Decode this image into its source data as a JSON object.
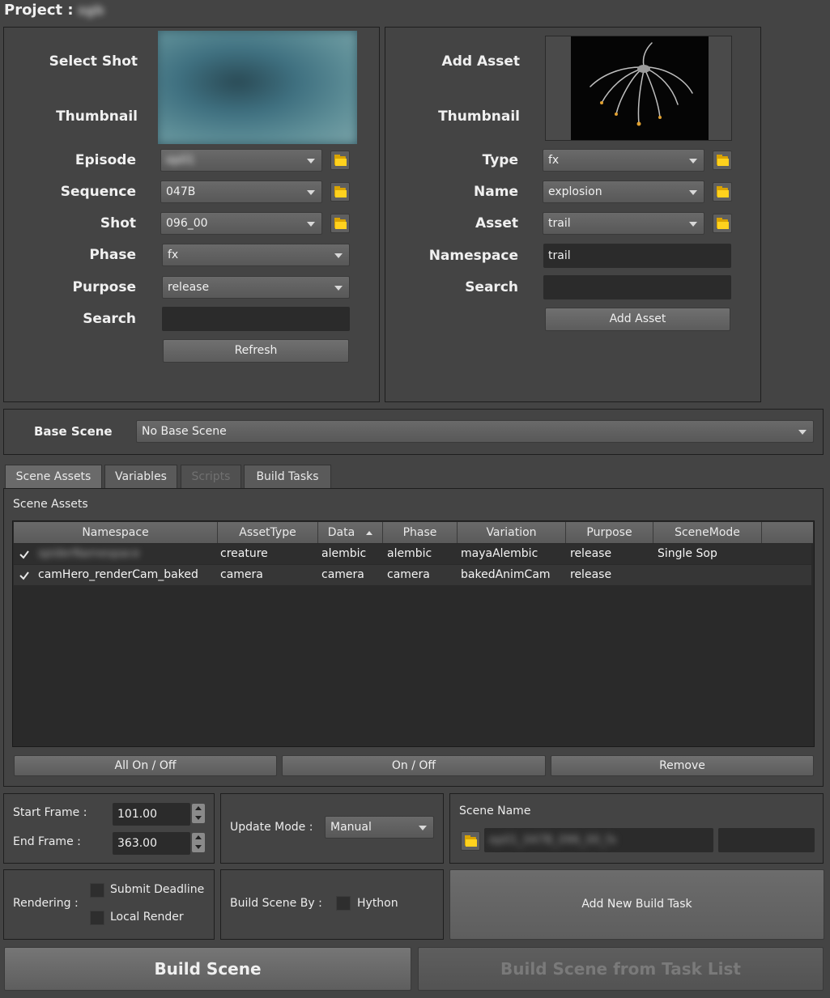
{
  "project": {
    "label": "Project :",
    "value": "sgb"
  },
  "shot_panel": {
    "select_shot": "Select Shot",
    "thumbnail": "Thumbnail",
    "episode_label": "Episode",
    "episode_value": "ep01",
    "sequence_label": "Sequence",
    "sequence_value": "047B",
    "shot_label": "Shot",
    "shot_value": "096_00",
    "phase_label": "Phase",
    "phase_value": "fx",
    "purpose_label": "Purpose",
    "purpose_value": "release",
    "search_label": "Search",
    "search_value": "",
    "refresh_button": "Refresh"
  },
  "asset_panel": {
    "add_asset": "Add Asset",
    "thumbnail": "Thumbnail",
    "type_label": "Type",
    "type_value": "fx",
    "name_label": "Name",
    "name_value": "explosion",
    "asset_label": "Asset",
    "asset_value": "trail",
    "namespace_label": "Namespace",
    "namespace_value": "trail",
    "search_label": "Search",
    "search_value": "",
    "add_asset_button": "Add Asset"
  },
  "base_scene": {
    "label": "Base Scene",
    "value": "No Base Scene"
  },
  "tabs": [
    {
      "label": "Scene Assets"
    },
    {
      "label": "Variables"
    },
    {
      "label": "Scripts"
    },
    {
      "label": "Build Tasks"
    }
  ],
  "scene_assets": {
    "title": "Scene Assets",
    "columns": [
      "Namespace",
      "AssetType",
      "Data",
      "Phase",
      "Variation",
      "Purpose",
      "SceneMode"
    ],
    "rows": [
      {
        "namespace": "spiderNamespace",
        "assettype": "creature",
        "data": "alembic",
        "phase": "alembic",
        "variation": "mayaAlembic",
        "purpose": "release",
        "scenemode": "Single Sop"
      },
      {
        "namespace": "camHero_renderCam_baked",
        "assettype": "camera",
        "data": "camera",
        "phase": "camera",
        "variation": "bakedAnimCam",
        "purpose": "release",
        "scenemode": ""
      }
    ],
    "all_on_off": "All On / Off",
    "on_off": "On / Off",
    "remove": "Remove"
  },
  "frames": {
    "start_label": "Start Frame :",
    "start_value": "101.00",
    "end_label": "End Frame :",
    "end_value": "363.00"
  },
  "update_mode": {
    "label": "Update Mode :",
    "value": "Manual"
  },
  "scene_name": {
    "label": "Scene Name",
    "value": "ep01_047B_096_00_fx",
    "suffix": ""
  },
  "rendering": {
    "label": "Rendering :",
    "submit_deadline": "Submit Deadline",
    "local_render": "Local Render"
  },
  "build_by": {
    "label": "Build Scene By :",
    "option": "Hython"
  },
  "add_new_build_task": "Add New Build Task",
  "build_scene": "Build Scene",
  "build_from_task_list": "Build Scene from Task List",
  "colors": {
    "background": "#444444",
    "field": "#2b2b2b",
    "folder": "#ffd21e",
    "disabled_text": "#7a7a7a"
  }
}
